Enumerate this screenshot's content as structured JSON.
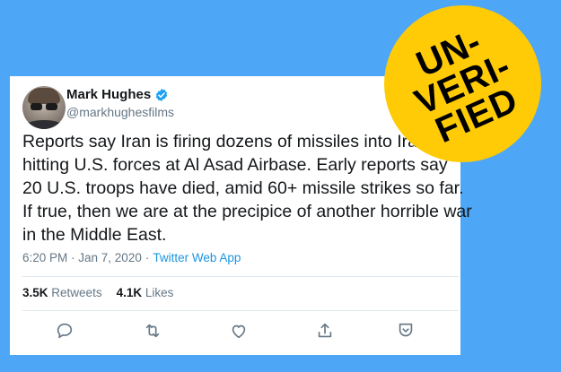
{
  "tweet": {
    "display_name": "Mark Hughes",
    "handle": "@markhughesfilms",
    "text_lines": [
      "Reports say Iran is firing dozens of missiles into Iraq,",
      "hitting U.S. forces at Al Asad Airbase. Early reports say",
      "20 U.S. troops have died, amid 60+ missile strikes so far.",
      "If true, then we are at the precipice of another horrible war",
      "in the Middle East."
    ],
    "timestamp": "6:20 PM · Jan 7, 2020",
    "separator": "·",
    "source": "Twitter Web App",
    "stats": {
      "retweets_count": "3.5K",
      "retweets_label": "Retweets",
      "likes_count": "4.1K",
      "likes_label": "Likes"
    },
    "actions": [
      "reply-icon",
      "retweet-icon",
      "like-icon",
      "share-icon",
      "tip-icon"
    ]
  },
  "badge": {
    "lines": [
      "UN-",
      "VERI-",
      "FIED"
    ]
  },
  "colors": {
    "background": "#4ea6f6",
    "badge": "#fecb06",
    "verified": "#1da1f2",
    "link": "#1b95e0",
    "secondary_text": "#657786"
  }
}
